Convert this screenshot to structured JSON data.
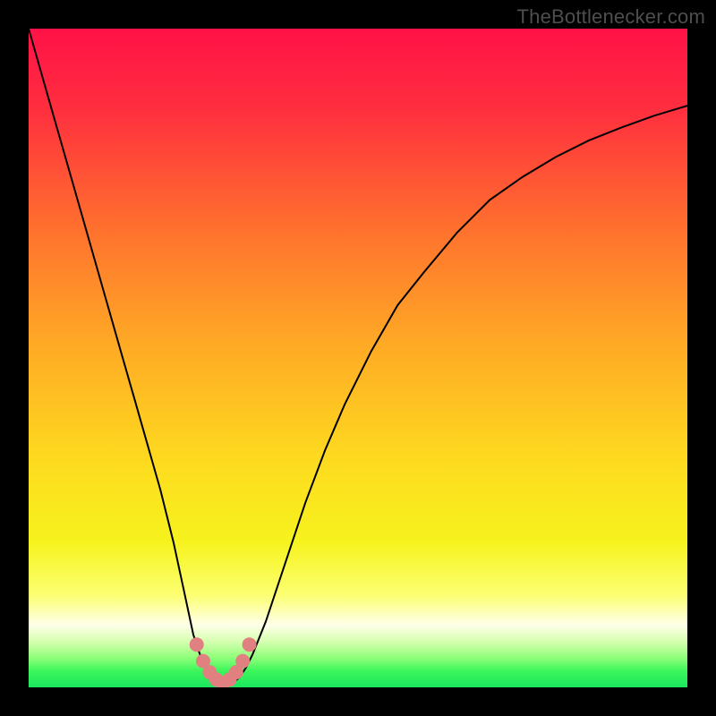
{
  "watermark": {
    "text": "TheBottlenecker.com"
  },
  "chart_data": {
    "type": "line",
    "title": "",
    "xlabel": "",
    "ylabel": "",
    "xlim": [
      0,
      100
    ],
    "ylim": [
      0,
      100
    ],
    "grid": false,
    "background_gradient": {
      "stops": [
        {
          "offset": 0.0,
          "color": "#ff1247"
        },
        {
          "offset": 0.12,
          "color": "#ff2e3f"
        },
        {
          "offset": 0.3,
          "color": "#ff6f2e"
        },
        {
          "offset": 0.48,
          "color": "#ffaa25"
        },
        {
          "offset": 0.65,
          "color": "#fed91f"
        },
        {
          "offset": 0.78,
          "color": "#f6f31e"
        },
        {
          "offset": 0.86,
          "color": "#fcff72"
        },
        {
          "offset": 0.905,
          "color": "#ffffe8"
        },
        {
          "offset": 0.93,
          "color": "#d7ffb1"
        },
        {
          "offset": 0.955,
          "color": "#8fff7a"
        },
        {
          "offset": 0.975,
          "color": "#3cf65c"
        },
        {
          "offset": 1.0,
          "color": "#1ae65e"
        }
      ]
    },
    "series": [
      {
        "name": "bottleneck-curve",
        "color": "#000000",
        "stroke_width": 2,
        "x": [
          0,
          2,
          4,
          6,
          8,
          10,
          12,
          14,
          16,
          18,
          20,
          22,
          23.5,
          25,
          26,
          27,
          28,
          29,
          30,
          31,
          32,
          33,
          34,
          36,
          38,
          40,
          42,
          45,
          48,
          52,
          56,
          60,
          65,
          70,
          75,
          80,
          85,
          90,
          95,
          100
        ],
        "y": [
          100,
          93,
          86,
          79,
          72,
          65,
          58,
          51,
          44,
          37,
          30,
          22,
          15,
          8,
          5,
          3,
          1.5,
          0.7,
          0.3,
          0.7,
          1.5,
          3,
          5,
          10,
          16,
          22,
          28,
          36,
          43,
          51,
          58,
          63,
          69,
          74,
          77.5,
          80.5,
          83,
          85,
          86.8,
          88.3
        ]
      },
      {
        "name": "highlight-marks",
        "type": "scatter",
        "color": "#e08080",
        "marker_size": 8,
        "x": [
          25.5,
          26.5,
          27.5,
          28.5,
          29.5,
          30.5,
          31.5,
          32.5,
          33.5
        ],
        "y": [
          6.5,
          4.0,
          2.3,
          1.2,
          0.6,
          1.2,
          2.3,
          4.0,
          6.5
        ]
      }
    ]
  }
}
